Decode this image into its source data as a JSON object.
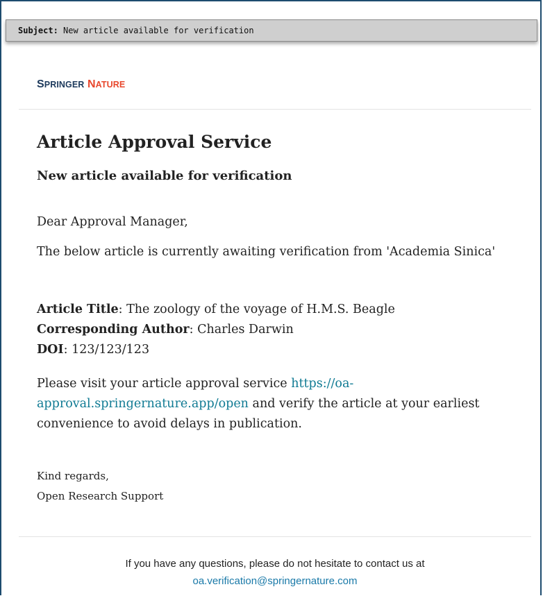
{
  "email": {
    "subject_label": "Subject:",
    "subject": "New article available for verification"
  },
  "brand": {
    "springer_initial": "S",
    "springer_rest": "PRINGER",
    "nature_initial": "N",
    "nature_rest": "ATURE",
    "colors": {
      "springer": "#1d3a5c",
      "nature": "#e8472c"
    }
  },
  "body": {
    "title": "Article Approval Service",
    "subtitle": "New article available for verification",
    "greeting": "Dear Approval Manager,",
    "intro": "The below article is currently awaiting verification from 'Academia Sinica'",
    "article_title_label": "Article Title",
    "article_title": "The zoology of the voyage of H.M.S. Beagle",
    "author_label": "Corresponding Author",
    "author": "Charles Darwin",
    "doi_label": "DOI",
    "doi": "123/123/123",
    "visit_prefix": "Please visit your article approval service ",
    "visit_link": "https://oa-approval.springernature.app/open",
    "visit_suffix": " and verify the article at your earliest convenience to avoid delays in publication.",
    "closing": "Kind regards,",
    "signature": "Open Research Support"
  },
  "footer": {
    "text": "If you have any questions, please do not hesitate to contact us at",
    "email": "oa.verification@springernature.com",
    "link_color": "#1979a8"
  }
}
